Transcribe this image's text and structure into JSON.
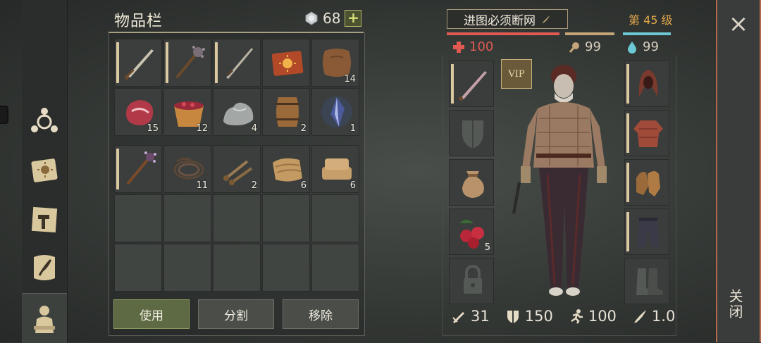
{
  "inventory": {
    "title": "物品栏",
    "gem_count": "68",
    "rows": [
      [
        {
          "icon": "sword-icon",
          "qty": "",
          "dur": true
        },
        {
          "icon": "mace-icon",
          "qty": "",
          "dur": true
        },
        {
          "icon": "longsword-icon",
          "qty": "",
          "dur": true
        },
        {
          "icon": "recipe-book-icon",
          "qty": ""
        },
        {
          "icon": "leather-hide-icon",
          "qty": "14"
        }
      ],
      [
        {
          "icon": "raw-meat-icon",
          "qty": "15"
        },
        {
          "icon": "berry-bowl-icon",
          "qty": "12"
        },
        {
          "icon": "stone-icon",
          "qty": "4"
        },
        {
          "icon": "barrel-icon",
          "qty": "2"
        },
        {
          "icon": "crystal-shard-icon",
          "qty": "1"
        }
      ]
    ],
    "rows2": [
      [
        {
          "icon": "spiked-mace-icon",
          "qty": "",
          "dur": true
        },
        {
          "icon": "rope-icon",
          "qty": "11"
        },
        {
          "icon": "nails-icon",
          "qty": "2"
        },
        {
          "icon": "fabric-roll-icon",
          "qty": "6"
        },
        {
          "icon": "folded-cloth-icon",
          "qty": "6"
        }
      ]
    ],
    "buttons": {
      "use": "使用",
      "split": "分割",
      "remove": "移除"
    }
  },
  "character": {
    "name": "进图必须断网",
    "level": "第 45 级",
    "health": "100",
    "food": "99",
    "water": "99",
    "vip_label": "VIP",
    "berries_qty": "5",
    "stats": {
      "attack": "31",
      "armor": "150",
      "speed": "100",
      "weight": "1.0"
    },
    "colors": {
      "health": "#e05a52",
      "food": "#c4a577",
      "water": "#6cc8d3",
      "level": "#e3a84a"
    }
  },
  "close": {
    "symbol": "×",
    "label": "关闭"
  }
}
